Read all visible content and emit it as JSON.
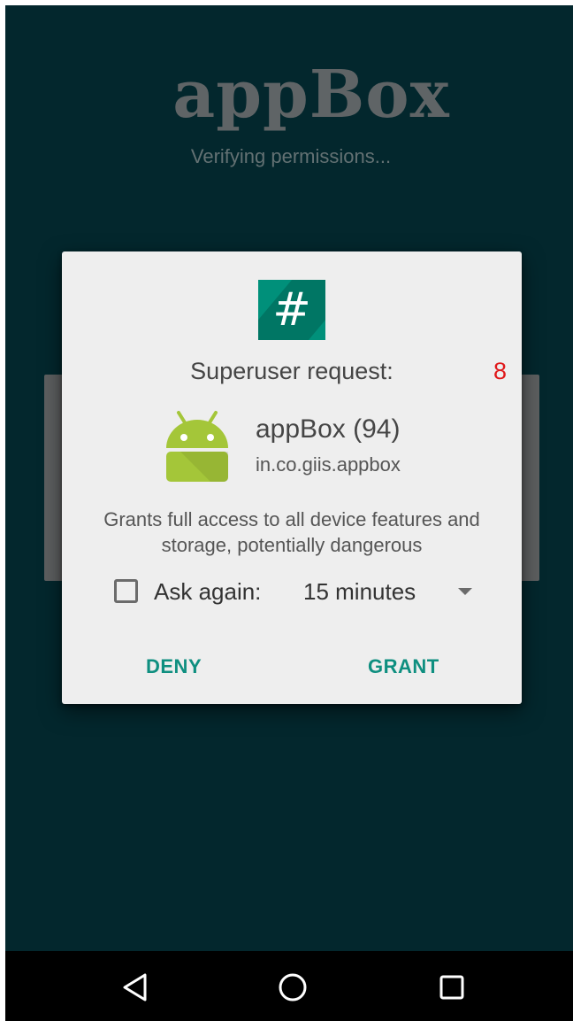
{
  "background": {
    "app_title": "appBox",
    "status_text": "Verifying permissions..."
  },
  "dialog": {
    "icon": "superuser-hash-icon",
    "title": "Superuser request:",
    "countdown": "8",
    "app": {
      "icon": "android-robot-icon",
      "name": "appBox (94)",
      "package": "in.co.giis.appbox"
    },
    "description": "Grants full access to all device features and storage, potentially dangerous",
    "ask_again": {
      "label": "Ask again:",
      "checked": false,
      "selected_duration": "15 minutes"
    },
    "buttons": {
      "deny": "DENY",
      "grant": "GRANT"
    }
  },
  "navbar": {
    "back_icon": "back-triangle-icon",
    "home_icon": "home-circle-icon",
    "recents_icon": "recents-square-icon"
  },
  "colors": {
    "screen_background": "#03272d",
    "dialog_background": "#eeeeee",
    "accent": "#0f8f80",
    "icon_teal": "#00907a",
    "countdown_red": "#e0191b",
    "android_green": "#a4c639"
  }
}
